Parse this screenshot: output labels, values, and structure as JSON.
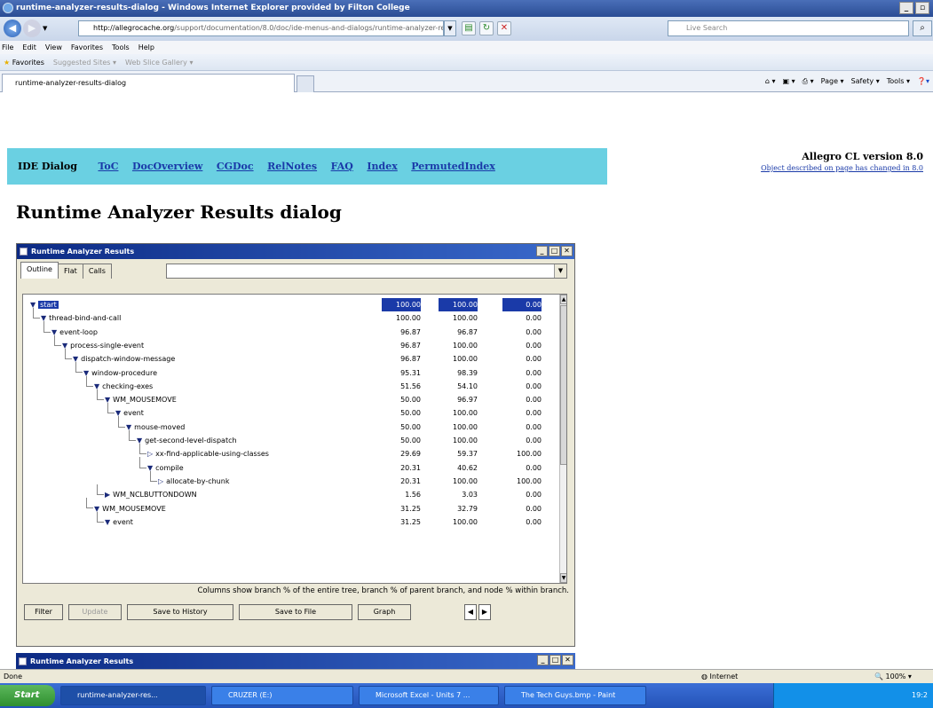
{
  "window": {
    "title": "runtime-analyzer-results-dialog - Windows Internet Explorer provided by Filton College"
  },
  "address": {
    "url_host": "http://allegrocache.org",
    "url_path": "/support/documentation/8.0/doc/ide-menus-and-dialogs/runtime-analyzer-results-di",
    "search_placeholder": "Live Search"
  },
  "menu": [
    "File",
    "Edit",
    "View",
    "Favorites",
    "Tools",
    "Help"
  ],
  "favbar": {
    "favorites": "Favorites",
    "suggested": "Suggested Sites",
    "gallery": "Web Slice Gallery"
  },
  "tab": {
    "label": "runtime-analyzer-results-dialog"
  },
  "commands": [
    "Page",
    "Safety",
    "Tools"
  ],
  "page": {
    "ide": "IDE Dialog",
    "links": [
      "ToC",
      "DocOverview",
      "CGDoc",
      "RelNotes",
      "FAQ",
      "Index",
      "PermutedIndex"
    ],
    "version": "Allegro CL version 8.0",
    "changed": "Object described on page has changed in 8.0",
    "title": "Runtime Analyzer Results dialog"
  },
  "dialog": {
    "title": "Runtime Analyzer Results",
    "tabs": [
      "Outline",
      "Flat",
      "Calls"
    ],
    "rows": [
      {
        "label": "start",
        "a": "100.00",
        "b": "100.00",
        "c": "0.00",
        "depth": 0,
        "glyph": "▼",
        "sel": true
      },
      {
        "label": "thread-bind-and-call",
        "a": "100.00",
        "b": "100.00",
        "c": "0.00",
        "depth": 1,
        "glyph": "▼"
      },
      {
        "label": "event-loop",
        "a": "96.87",
        "b": "96.87",
        "c": "0.00",
        "depth": 2,
        "glyph": "▼"
      },
      {
        "label": "process-single-event",
        "a": "96.87",
        "b": "100.00",
        "c": "0.00",
        "depth": 3,
        "glyph": "▼"
      },
      {
        "label": "dispatch-window-message",
        "a": "96.87",
        "b": "100.00",
        "c": "0.00",
        "depth": 4,
        "glyph": "▼"
      },
      {
        "label": "window-procedure",
        "a": "95.31",
        "b": "98.39",
        "c": "0.00",
        "depth": 5,
        "glyph": "▼"
      },
      {
        "label": "checking-exes",
        "a": "51.56",
        "b": "54.10",
        "c": "0.00",
        "depth": 6,
        "glyph": "▼"
      },
      {
        "label": "WM_MOUSEMOVE",
        "a": "50.00",
        "b": "96.97",
        "c": "0.00",
        "depth": 7,
        "glyph": "▼"
      },
      {
        "label": "event",
        "a": "50.00",
        "b": "100.00",
        "c": "0.00",
        "depth": 8,
        "glyph": "▼"
      },
      {
        "label": "mouse-moved",
        "a": "50.00",
        "b": "100.00",
        "c": "0.00",
        "depth": 9,
        "glyph": "▼"
      },
      {
        "label": "get-second-level-dispatch",
        "a": "50.00",
        "b": "100.00",
        "c": "0.00",
        "depth": 10,
        "glyph": "▼"
      },
      {
        "label": "xx-find-applicable-using-classes",
        "a": "29.69",
        "b": "59.37",
        "c": "100.00",
        "depth": 11,
        "glyph": "▷"
      },
      {
        "label": "compile",
        "a": "20.31",
        "b": "40.62",
        "c": "0.00",
        "depth": 11,
        "glyph": "▼"
      },
      {
        "label": "allocate-by-chunk",
        "a": "20.31",
        "b": "100.00",
        "c": "100.00",
        "depth": 12,
        "glyph": "▷"
      },
      {
        "label": "WM_NCLBUTTONDOWN",
        "a": "1.56",
        "b": "3.03",
        "c": "0.00",
        "depth": 7,
        "glyph": "▶"
      },
      {
        "label": "WM_MOUSEMOVE",
        "a": "31.25",
        "b": "32.79",
        "c": "0.00",
        "depth": 6,
        "glyph": "▼"
      },
      {
        "label": "event",
        "a": "31.25",
        "b": "100.00",
        "c": "0.00",
        "depth": 7,
        "glyph": "▼"
      }
    ],
    "footnote": "Columns show branch % of the entire tree, branch % of parent branch, and node % within branch.",
    "buttons": [
      "Filter",
      "Update",
      "Save to History",
      "Save to File",
      "Graph"
    ],
    "second_title": "Runtime Analyzer Results"
  },
  "status": {
    "left": "Done",
    "zone": "Internet",
    "zoom": "100%"
  },
  "taskbar": {
    "start": "Start",
    "items": [
      "runtime-analyzer-res...",
      "CRUZER (E:)",
      "Microsoft Excel - Units 7 ...",
      "The Tech Guys.bmp - Paint"
    ],
    "clock": "19:2"
  }
}
